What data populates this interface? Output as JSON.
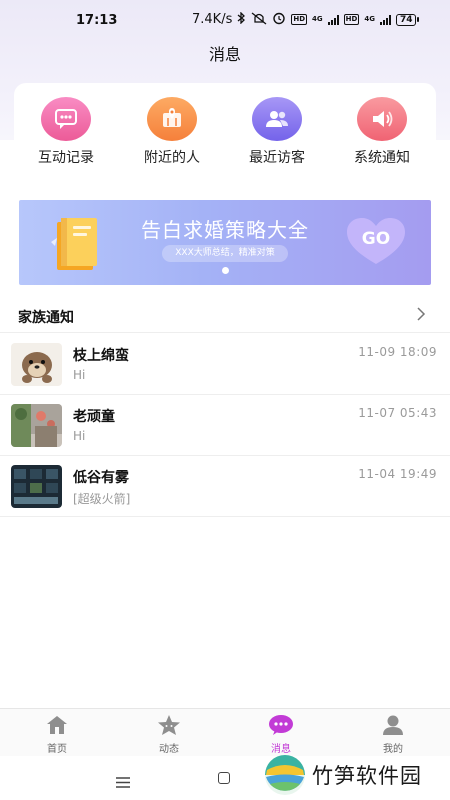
{
  "status_bar": {
    "time": "17:13",
    "net_speed": "7.4K/s",
    "hd1": "HD",
    "net1": "4G",
    "hd2": "HD",
    "net2": "4G",
    "battery": "74",
    "icons": [
      "bluetooth-icon",
      "mute-icon",
      "alarm-icon",
      "signal-icon",
      "battery-icon"
    ]
  },
  "header": {
    "title": "消息"
  },
  "quick_entries": [
    {
      "label": "互动记录",
      "icon": "chat-bubble-icon",
      "color": "#f06aa7"
    },
    {
      "label": "附近的人",
      "icon": "map-pin-icon",
      "color": "#f98e4a"
    },
    {
      "label": "最近访客",
      "icon": "users-icon",
      "color": "#8b78f0"
    },
    {
      "label": "系统通知",
      "icon": "speaker-icon",
      "color": "#f5707f"
    }
  ],
  "banner": {
    "title": "告白求婚策略大全",
    "subtitle": "XXX大师总结，精准对策",
    "button": "GO"
  },
  "family_notice": {
    "label": "家族通知"
  },
  "messages": [
    {
      "name": "枝上绵蛮",
      "preview": "Hi",
      "time": "11-09 18:09",
      "avatar": "otter-avatar"
    },
    {
      "name": "老顽童",
      "preview": "Hi",
      "time": "11-07 05:43",
      "avatar": "garden-photo-avatar"
    },
    {
      "name": "低谷有雾",
      "preview": "[超级火箭]",
      "time": "11-04 19:49",
      "avatar": "game-screenshot-avatar"
    }
  ],
  "tabs": [
    {
      "label": "首页",
      "icon": "home-icon",
      "active": false
    },
    {
      "label": "动态",
      "icon": "star-icon",
      "active": false
    },
    {
      "label": "消息",
      "icon": "message-icon",
      "active": true
    },
    {
      "label": "我的",
      "icon": "profile-icon",
      "active": false
    }
  ],
  "watermark": {
    "text": "竹笋软件园"
  },
  "colors": {
    "accent": "#c23bd6",
    "banner_start": "#b7c7fb",
    "banner_end": "#a49cf0"
  }
}
